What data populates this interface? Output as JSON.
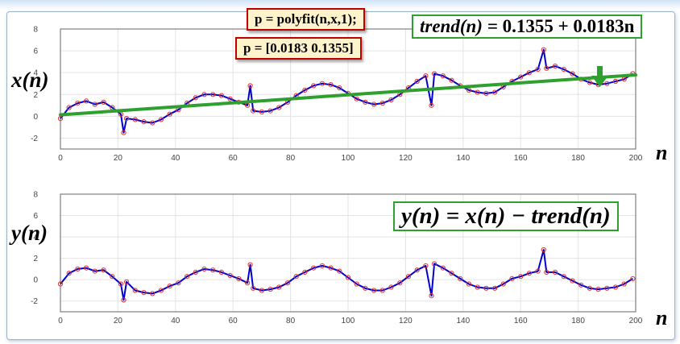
{
  "annotations": {
    "polyfit_code": "p = polyfit(n,x,1);",
    "polyfit_result": "p =  [0.0183  0.1355]",
    "trend_eq": {
      "lhs": "trend(n) = ",
      "rhs": "0.1355 + 0.0183n"
    },
    "detrend_eq": "y(n) = x(n) − trend(n)"
  },
  "colors": {
    "line": "#0000cc",
    "marker": "#e03030",
    "trend": "#2ea02e",
    "grid": "#e3e3e3",
    "axis": "#666666"
  },
  "chart_data": [
    {
      "type": "line",
      "ylabel": "x(n)",
      "xlabel": "n",
      "xlim": [
        0,
        200
      ],
      "ylim": [
        -3,
        8
      ],
      "xticks": [
        0,
        20,
        40,
        60,
        80,
        100,
        120,
        140,
        160,
        180,
        200
      ],
      "yticks": [
        -2,
        0,
        2,
        4,
        6,
        8
      ],
      "grid": true,
      "series": [
        {
          "x": [
            0,
            3,
            6,
            9,
            12,
            15,
            18,
            21,
            22,
            23,
            26,
            29,
            32,
            35,
            38,
            41,
            44,
            47,
            50,
            53,
            56,
            59,
            62,
            65,
            66,
            67,
            70,
            73,
            76,
            79,
            82,
            85,
            88,
            91,
            94,
            97,
            100,
            103,
            106,
            109,
            112,
            115,
            118,
            121,
            124,
            127,
            129,
            130,
            133,
            136,
            139,
            142,
            145,
            148,
            151,
            154,
            157,
            160,
            163,
            166,
            168,
            169,
            172,
            175,
            178,
            181,
            184,
            187,
            190,
            193,
            196,
            199
          ],
          "values": [
            -0.2,
            0.8,
            1.2,
            1.4,
            1.1,
            1.3,
            0.8,
            0.2,
            -1.5,
            -0.2,
            -0.3,
            -0.5,
            -0.6,
            -0.3,
            0.2,
            0.6,
            1.2,
            1.7,
            2.0,
            2.0,
            1.9,
            1.6,
            1.3,
            1.0,
            2.8,
            0.5,
            0.4,
            0.5,
            0.8,
            1.3,
            1.9,
            2.4,
            2.8,
            3.0,
            2.9,
            2.6,
            2.1,
            1.6,
            1.3,
            1.1,
            1.2,
            1.5,
            2.0,
            2.6,
            3.2,
            3.7,
            1.0,
            3.9,
            3.7,
            3.3,
            2.8,
            2.4,
            2.2,
            2.1,
            2.2,
            2.7,
            3.2,
            3.6,
            4.0,
            4.3,
            6.1,
            4.4,
            4.6,
            4.3,
            3.9,
            3.4,
            3.1,
            2.9,
            3.0,
            3.2,
            3.4,
            3.9
          ]
        },
        {
          "name": "trend",
          "x": [
            0,
            200
          ],
          "values": [
            0.1355,
            3.7955
          ]
        }
      ]
    },
    {
      "type": "line",
      "ylabel": "y(n)",
      "xlabel": "n",
      "xlim": [
        0,
        200
      ],
      "ylim": [
        -3,
        8
      ],
      "xticks": [
        0,
        20,
        40,
        60,
        80,
        100,
        120,
        140,
        160,
        180,
        200
      ],
      "yticks": [
        -2,
        0,
        2,
        4,
        6,
        8
      ],
      "grid": true,
      "series": [
        {
          "x": [
            0,
            3,
            6,
            9,
            12,
            15,
            18,
            21,
            22,
            23,
            26,
            29,
            32,
            35,
            38,
            41,
            44,
            47,
            50,
            53,
            56,
            59,
            62,
            65,
            66,
            67,
            70,
            73,
            76,
            79,
            82,
            85,
            88,
            91,
            94,
            97,
            100,
            103,
            106,
            109,
            112,
            115,
            118,
            121,
            124,
            127,
            129,
            130,
            133,
            136,
            139,
            142,
            145,
            148,
            151,
            154,
            157,
            160,
            163,
            166,
            168,
            169,
            172,
            175,
            178,
            181,
            184,
            187,
            190,
            193,
            196,
            199
          ],
          "values": [
            -0.4,
            0.6,
            1.0,
            1.1,
            0.8,
            0.9,
            0.3,
            -0.4,
            -1.9,
            -0.2,
            -1.0,
            -1.2,
            -1.3,
            -1.0,
            -0.6,
            -0.3,
            0.3,
            0.7,
            1.0,
            0.9,
            0.7,
            0.4,
            0.1,
            -0.3,
            1.4,
            -0.8,
            -1.0,
            -0.9,
            -0.7,
            -0.3,
            0.3,
            0.7,
            1.1,
            1.3,
            1.1,
            0.8,
            0.2,
            -0.4,
            -0.8,
            -1.0,
            -1.0,
            -0.7,
            -0.3,
            0.3,
            0.9,
            1.3,
            -1.5,
            1.5,
            1.1,
            0.6,
            0.1,
            -0.4,
            -0.7,
            -0.8,
            -0.8,
            -0.4,
            0.1,
            0.3,
            0.6,
            0.8,
            2.8,
            0.7,
            0.7,
            0.3,
            -0.1,
            -0.5,
            -0.8,
            -0.9,
            -0.8,
            -0.7,
            -0.4,
            0.1
          ]
        }
      ]
    }
  ]
}
